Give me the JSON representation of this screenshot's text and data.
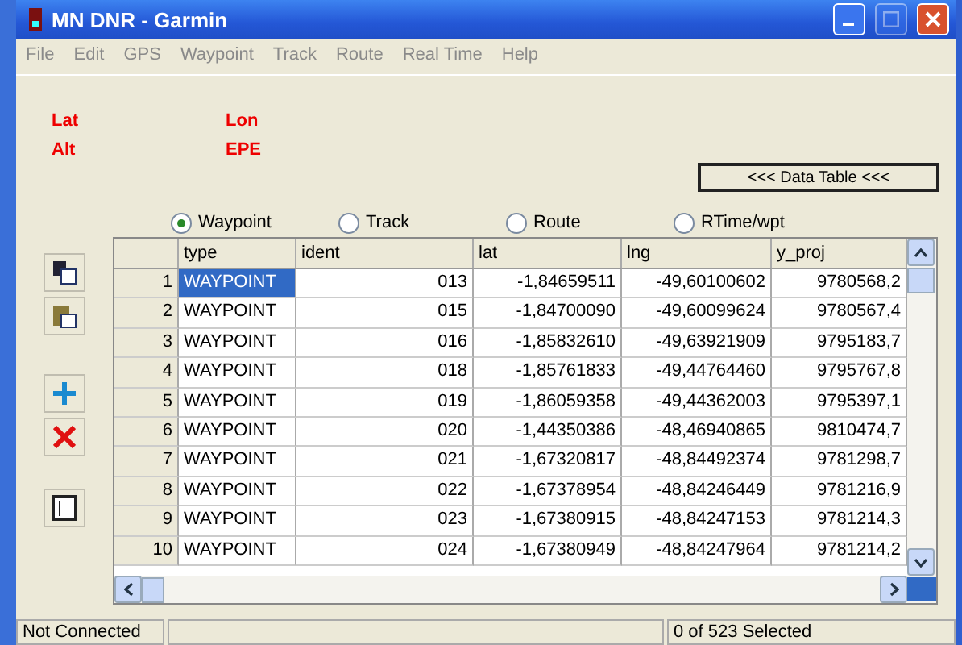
{
  "window": {
    "title": "MN DNR - Garmin",
    "controls": [
      {
        "kind": "minimize",
        "disabled": false
      },
      {
        "kind": "maximize",
        "disabled": true
      },
      {
        "kind": "close",
        "disabled": false
      }
    ]
  },
  "menu": [
    "File",
    "Edit",
    "GPS",
    "Waypoint",
    "Track",
    "Route",
    "Real Time",
    "Help"
  ],
  "gps_labels": [
    {
      "label": "Lat"
    },
    {
      "label": "Lon"
    },
    {
      "label": "Alt"
    },
    {
      "label": "EPE"
    }
  ],
  "data_table_button": "<<< Data Table <<<",
  "modes": [
    {
      "label": "Waypoint",
      "selected": true
    },
    {
      "label": "Track",
      "selected": false
    },
    {
      "label": "Route",
      "selected": false
    },
    {
      "label": "RTime/wpt",
      "selected": false
    }
  ],
  "table": {
    "columns": [
      "type",
      "ident",
      "lat",
      "lng",
      "y_proj"
    ],
    "rows": [
      {
        "number": "1",
        "selected": true,
        "cells": [
          "WAYPOINT",
          "013",
          "-1,84659511",
          "-49,60100602",
          "9780568,2"
        ]
      },
      {
        "number": "2",
        "selected": false,
        "cells": [
          "WAYPOINT",
          "015",
          "-1,84700090",
          "-49,60099624",
          "9780567,4"
        ]
      },
      {
        "number": "3",
        "selected": false,
        "cells": [
          "WAYPOINT",
          "016",
          "-1,85832610",
          "-49,63921909",
          "9795183,7"
        ]
      },
      {
        "number": "4",
        "selected": false,
        "cells": [
          "WAYPOINT",
          "018",
          "-1,85761833",
          "-49,44764460",
          "9795767,8"
        ]
      },
      {
        "number": "5",
        "selected": false,
        "cells": [
          "WAYPOINT",
          "019",
          "-1,86059358",
          "-49,44362003",
          "9795397,1"
        ]
      },
      {
        "number": "6",
        "selected": false,
        "cells": [
          "WAYPOINT",
          "020",
          "-1,44350386",
          "-48,46940865",
          "9810474,7"
        ]
      },
      {
        "number": "7",
        "selected": false,
        "cells": [
          "WAYPOINT",
          "021",
          "-1,67320817",
          "-48,84492374",
          "9781298,7"
        ]
      },
      {
        "number": "8",
        "selected": false,
        "cells": [
          "WAYPOINT",
          "022",
          "-1,67378954",
          "-48,84246449",
          "9781216,9"
        ]
      },
      {
        "number": "9",
        "selected": false,
        "cells": [
          "WAYPOINT",
          "023",
          "-1,67380915",
          "-48,84247153",
          "9781214,3"
        ]
      },
      {
        "number": "10",
        "selected": false,
        "cells": [
          "WAYPOINT",
          "024",
          "-1,67380949",
          "-48,84247964",
          "9781214,2"
        ]
      }
    ]
  },
  "status_bar": {
    "connection": "Not Connected",
    "selection": "0 of 523 Selected"
  }
}
